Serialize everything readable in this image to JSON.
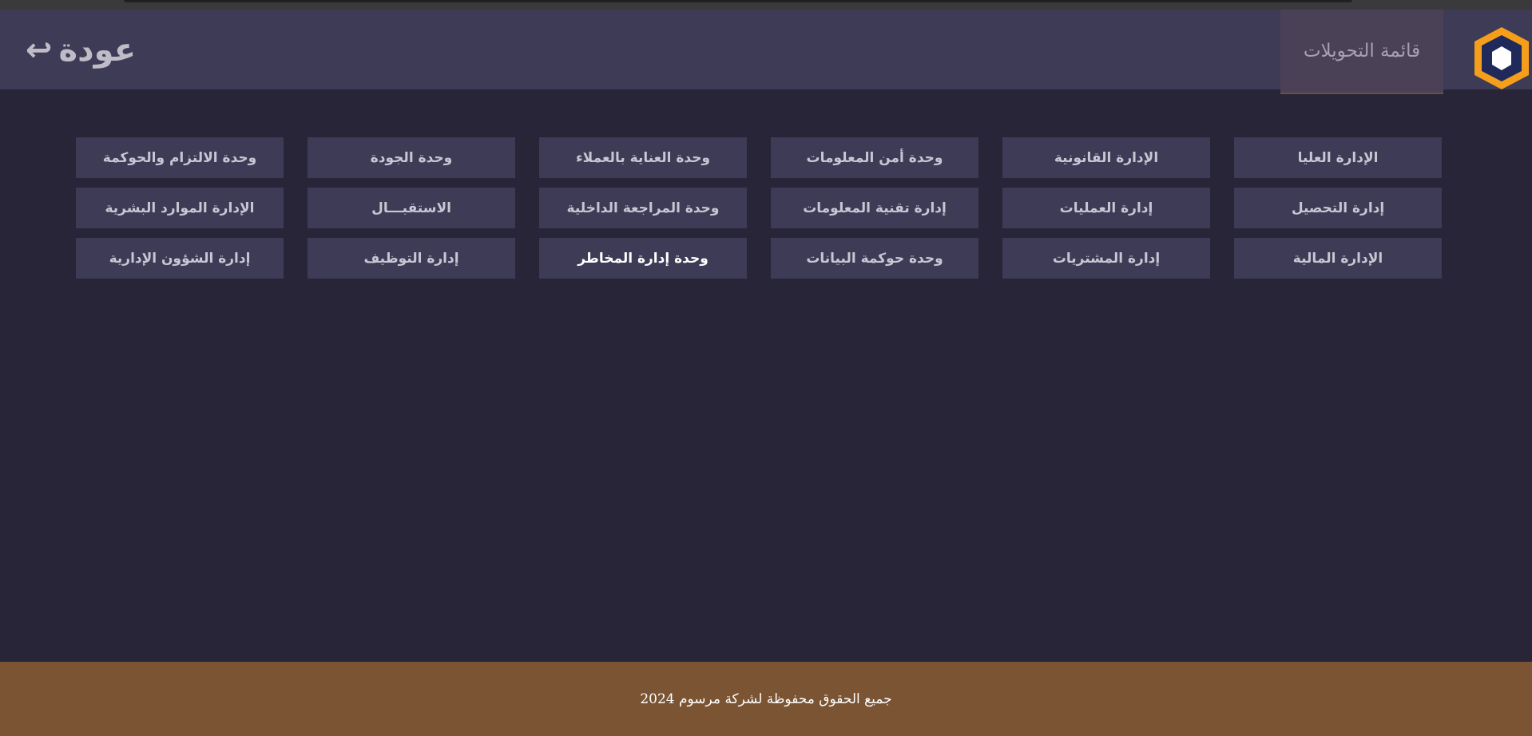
{
  "header": {
    "nav_tab_label": "قائمة التحويلات",
    "back_label": "عودة",
    "back_icon": "return-arrow-icon"
  },
  "logo": {
    "name": "hexagon-logo",
    "colors": [
      "#f59e1c",
      "#1f2a5a",
      "#ffffff"
    ]
  },
  "departments": [
    {
      "label": "الإدارة العليا"
    },
    {
      "label": "الإدارة القانونية"
    },
    {
      "label": "وحدة أمن المعلومات"
    },
    {
      "label": "وحدة العناية بالعملاء"
    },
    {
      "label": "وحدة الجودة"
    },
    {
      "label": "وحدة الالتزام والحوكمة"
    },
    {
      "label": "إدارة التحصيل"
    },
    {
      "label": "إدارة العمليات"
    },
    {
      "label": "إدارة تقنية المعلومات"
    },
    {
      "label": "وحدة المراجعة الداخلية"
    },
    {
      "label": "الاستقبـــال"
    },
    {
      "label": "الإدارة الموارد البشرية"
    },
    {
      "label": "الإدارة المالية"
    },
    {
      "label": "إدارة المشتريات"
    },
    {
      "label": "وحدة حوكمة البيانات"
    },
    {
      "label": "وحدة إدارة المخاطر",
      "active": true
    },
    {
      "label": "إدارة التوظيف"
    },
    {
      "label": "إدارة الشؤون الإدارية"
    }
  ],
  "footer": {
    "text": "جميع الحقوق محفوظة لشركة مرسوم 2024"
  },
  "colors": {
    "background": "#272537",
    "panel": "#3e3b56",
    "footer": "#7b5434",
    "accent": "#f59e1c"
  }
}
